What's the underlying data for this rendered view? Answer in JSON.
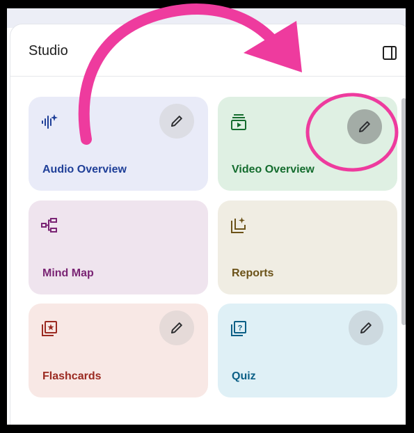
{
  "panel": {
    "title": "Studio",
    "collapse_icon": "sidebar-toggle-icon"
  },
  "cards": [
    {
      "id": "audio-overview",
      "label": "Audio Overview",
      "icon": "audio-waveform-sparkle-icon",
      "bg": "#e9ebf8",
      "fg": "#1f3f98",
      "has_edit": true
    },
    {
      "id": "video-overview",
      "label": "Video Overview",
      "icon": "video-stack-icon",
      "bg": "#dff0e3",
      "fg": "#146c2e",
      "has_edit": true
    },
    {
      "id": "mind-map",
      "label": "Mind Map",
      "icon": "mind-map-icon",
      "bg": "#efe4ee",
      "fg": "#7a2474",
      "has_edit": false
    },
    {
      "id": "reports",
      "label": "Reports",
      "icon": "report-sparkle-icon",
      "bg": "#f0ede3",
      "fg": "#6b5218",
      "has_edit": false
    },
    {
      "id": "flashcards",
      "label": "Flashcards",
      "icon": "flashcard-star-icon",
      "bg": "#f8e8e5",
      "fg": "#9b2a21",
      "has_edit": true
    },
    {
      "id": "quiz",
      "label": "Quiz",
      "icon": "quiz-question-icon",
      "bg": "#dff0f6",
      "fg": "#0b5f86",
      "has_edit": true
    }
  ],
  "annotation_colors": {
    "arrow": "#ee3b9e",
    "highlight": "#ee3b9e"
  }
}
